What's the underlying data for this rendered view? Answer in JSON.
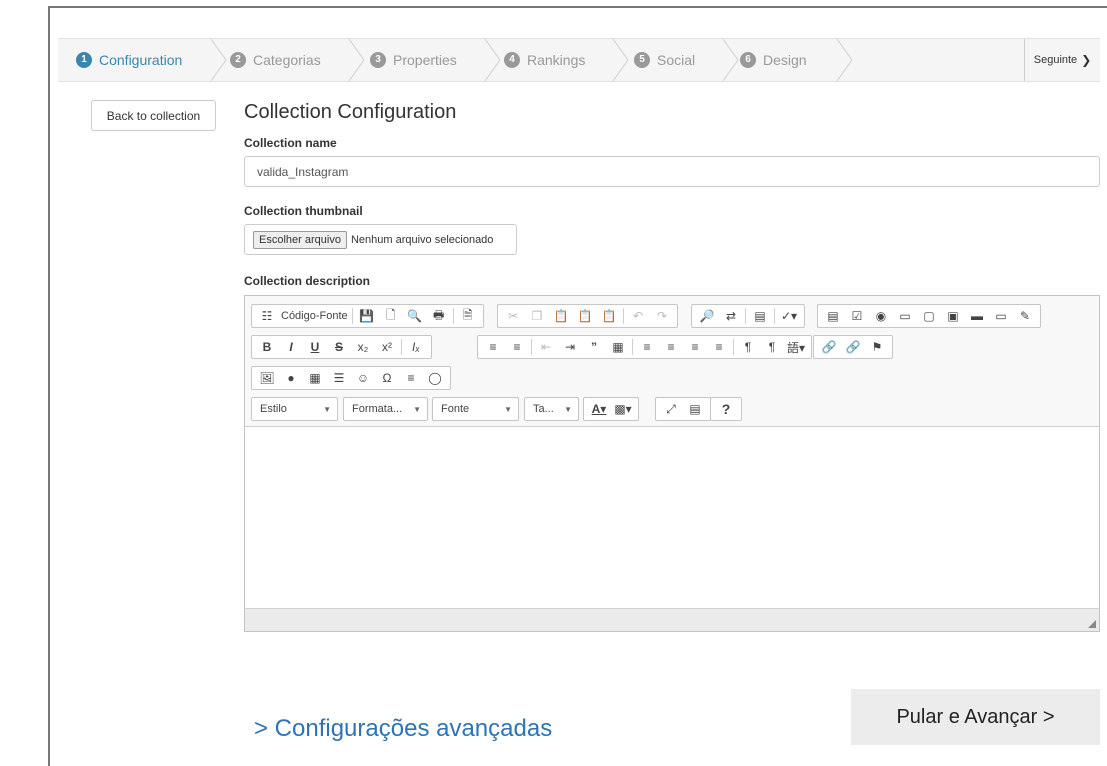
{
  "wizard": {
    "steps": [
      {
        "num": "1",
        "label": "Configuration"
      },
      {
        "num": "2",
        "label": "Categorias"
      },
      {
        "num": "3",
        "label": "Properties"
      },
      {
        "num": "4",
        "label": "Rankings"
      },
      {
        "num": "5",
        "label": "Social"
      },
      {
        "num": "6",
        "label": "Design"
      }
    ],
    "active_step": "Configuration",
    "next_label": "Seguinte",
    "next_icon": "chevron-right"
  },
  "back_label": "Back to collection",
  "page_title": "Collection Configuration",
  "form": {
    "name_label": "Collection name",
    "name_value": "valida_Instagram",
    "thumbnail_label": "Collection thumbnail",
    "file_button": "Escolher arquivo",
    "file_status": "Nenhum arquivo selecionado",
    "description_label": "Collection description"
  },
  "editor": {
    "source_label": "Código-Fonte",
    "bold": "B",
    "italic": "I",
    "underline": "U",
    "strike": "S",
    "combos": {
      "style": "Estilo",
      "format": "Formata...",
      "font": "Fonte",
      "size": "Ta..."
    },
    "help": "?"
  },
  "footer": {
    "advanced_link": "> Configurações avançadas",
    "skip_button": "Pular e Avançar >"
  },
  "colors": {
    "accent": "#3a87ad",
    "link": "#2e74b5"
  }
}
